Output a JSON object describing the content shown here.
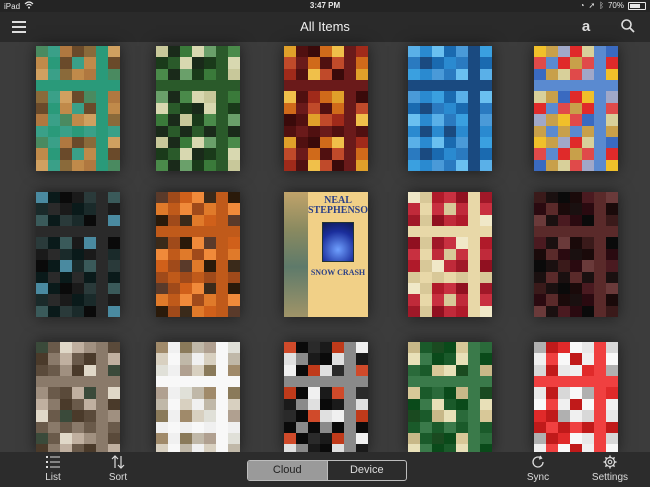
{
  "status": {
    "device": "iPad",
    "time": "3:47 PM",
    "battery": "70%",
    "battery_level": 0.7
  },
  "header": {
    "title": "All Items",
    "menu_icon": "hamburger-menu-icon",
    "store_icon": "amazon-store-icon",
    "search_icon": "search-icon"
  },
  "books": [
    {
      "cover": "pixelated",
      "colors": [
        "#4a8a60",
        "#2a9a7a",
        "#b07840",
        "#c08a4a",
        "#8a6a3a",
        "#3aa088",
        "#d0a060",
        "#6a4a2a"
      ]
    },
    {
      "cover": "pixelated",
      "colors": [
        "#d8d8b0",
        "#c8c89a",
        "#2a5a2a",
        "#3a7a3a",
        "#1a3a1a",
        "#6aa06a",
        "#1a2a1a",
        "#4a8a4a"
      ]
    },
    {
      "cover": "pixelated",
      "colors": [
        "#a02a1a",
        "#d06a1a",
        "#e0a02a",
        "#6a1a1a",
        "#3a0a0a",
        "#c04a2a",
        "#f0c04a",
        "#501010"
      ]
    },
    {
      "cover": "pixelated",
      "colors": [
        "#2a8ad0",
        "#3aa0e0",
        "#1a6ab0",
        "#5ab0e8",
        "#1a4a80",
        "#6ac0f0",
        "#2a7ac0",
        "#4a9ad8"
      ]
    },
    {
      "cover": "pixelated",
      "colors": [
        "#d8d09a",
        "#c8a04a",
        "#3a6ac0",
        "#e02a2a",
        "#f0c02a",
        "#5a8ad0",
        "#a0a8c8",
        "#e04a4a"
      ]
    },
    {
      "cover": "pixelated",
      "colors": [
        "#1a2a2a",
        "#2a3a3a",
        "#0a1a1a",
        "#3a5a5a",
        "#1a1a1a",
        "#4a8aa0",
        "#2a2a2a",
        "#0a0a0a"
      ]
    },
    {
      "cover": "pixelated",
      "colors": [
        "#d0601a",
        "#e07a2a",
        "#3a2a1a",
        "#a04a1a",
        "#2a1a0a",
        "#f08a3a",
        "#5a3a2a",
        "#c05a1a"
      ]
    },
    {
      "cover": "clear",
      "author": "NEAL STEPHENSON",
      "title": "SNOW CRASH"
    },
    {
      "cover": "pixelated",
      "colors": [
        "#f0e8c8",
        "#e8d8a8",
        "#b01a2a",
        "#c02a3a",
        "#901020",
        "#d8c898",
        "#a01828",
        "#c83040"
      ]
    },
    {
      "cover": "pixelated",
      "colors": [
        "#1a0a0a",
        "#3a1a1a",
        "#5a2a2a",
        "#0a0a0a",
        "#2a0a10",
        "#4a1a20",
        "#1a1010",
        "#6a3a3a"
      ]
    },
    {
      "cover": "pixelated",
      "colors": [
        "#5a4a3a",
        "#c0b0a0",
        "#3a4a3a",
        "#8a7a6a",
        "#e0d8c8",
        "#4a3a2a",
        "#a09080",
        "#6a5a4a"
      ]
    },
    {
      "cover": "pixelated",
      "colors": [
        "#f0f0f0",
        "#e0e0d8",
        "#c0b8a8",
        "#a08a6a",
        "#f8f8f8",
        "#8a7a5a",
        "#d8d0c0",
        "#b0a090"
      ]
    },
    {
      "cover": "pixelated",
      "colors": [
        "#c03a1a",
        "#0a0a0a",
        "#f0f0f0",
        "#1a1a1a",
        "#d04a2a",
        "#8a8a8a",
        "#2a2a2a",
        "#e0e0e0"
      ]
    },
    {
      "cover": "pixelated",
      "colors": [
        "#e8e0b8",
        "#d8c898",
        "#1a5a2a",
        "#2a6a3a",
        "#0a4a1a",
        "#c8b888",
        "#3a7a4a",
        "#1a4a20"
      ]
    },
    {
      "cover": "pixelated",
      "colors": [
        "#e02a2a",
        "#f0f0f0",
        "#e8e8e8",
        "#c01a1a",
        "#d8d8d8",
        "#f8f8f8",
        "#b0b0b0",
        "#f04040"
      ]
    }
  ],
  "toolbar": {
    "list": "List",
    "sort": "Sort",
    "cloud": "Cloud",
    "device": "Device",
    "sync": "Sync",
    "settings": "Settings",
    "selected": "Cloud"
  },
  "colors": {
    "accent": "#9a9a9a",
    "background": "#3c3c3c",
    "bar": "#2a2a2a"
  }
}
